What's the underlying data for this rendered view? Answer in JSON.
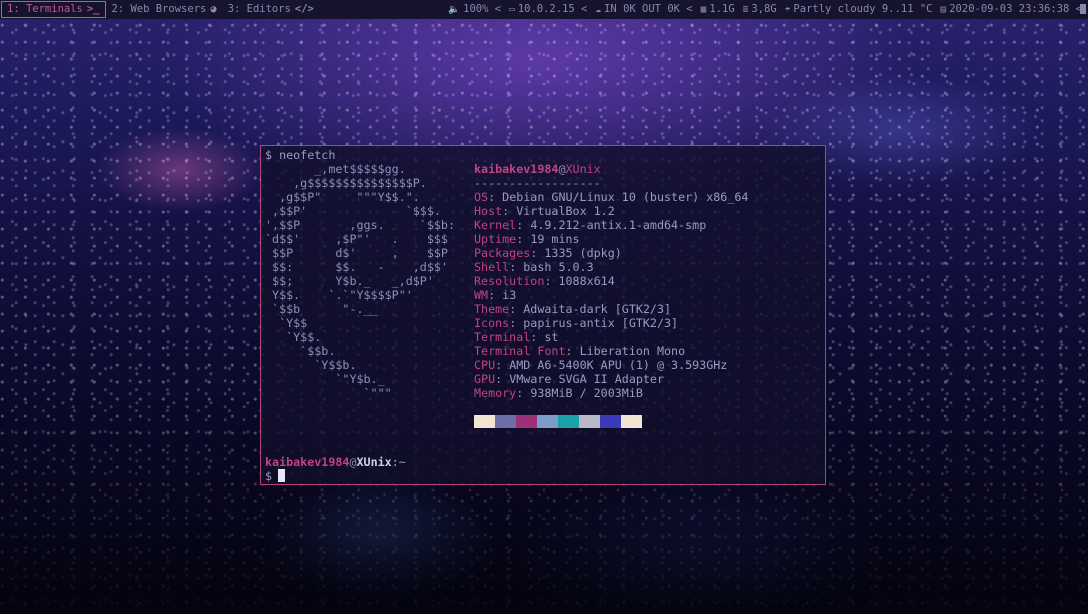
{
  "topbar": {
    "workspaces": [
      {
        "label": "1: Terminals",
        "icon": ">_",
        "icon_name": "terminal-icon",
        "active": true
      },
      {
        "label": "2: Web Browsers",
        "icon": "◕",
        "icon_name": "globe-icon",
        "active": false
      },
      {
        "label": "3: Editors",
        "icon": "</>",
        "icon_name": "code-icon",
        "active": false
      }
    ],
    "status": [
      {
        "icon": "🔈",
        "icon_name": "volume-icon",
        "text": "100% <"
      },
      {
        "icon": "▭",
        "icon_name": "network-icon",
        "text": "10.0.2.15 <"
      },
      {
        "icon": "☁",
        "icon_name": "cloud-traffic-icon",
        "text": "IN 0K OUT 0K <"
      },
      {
        "icon": "▦",
        "icon_name": "memory-icon",
        "text": "1.1G"
      },
      {
        "icon": "≣",
        "icon_name": "disk-icon",
        "text": "3,8G"
      },
      {
        "icon": "☂",
        "icon_name": "weather-icon",
        "text": "Partly cloudy 9..11 °C"
      },
      {
        "icon": "▤",
        "icon_name": "calendar-icon",
        "text": "2020-09-03 23:36:38 <"
      }
    ]
  },
  "terminal": {
    "command_prompt": "$ neofetch",
    "ascii_art": "       _,met$$$$$gg.\n    ,g$$$$$$$$$$$$$$$P.\n  ,g$$P\"     \"\"\"Y$$.\".\n ,$$P'              `$$$.\n',$$P       ,ggs.     `$$b:\n`d$$'     ,$P\"'   .    $$$\n $$P      d$'     ,    $$P\n $$:      $$.   -    ,d$$'\n $$;      Y$b._   _,d$P'\n Y$$.    `.`\"Y$$$$P\"'\n `$$b      \"-.__\n  `Y$$\n   `Y$$.\n     `$$b.\n       `Y$$b.\n          `\"Y$b._\n              `\"\"\"",
    "user": "kaibakev1984",
    "at": "@",
    "host": "XUnix",
    "separator": "------------------",
    "info": [
      {
        "key": "OS",
        "value": "Debian GNU/Linux 10 (buster) x86_64"
      },
      {
        "key": "Host",
        "value": "VirtualBox 1.2"
      },
      {
        "key": "Kernel",
        "value": "4.9.212-antix.1-amd64-smp"
      },
      {
        "key": "Uptime",
        "value": "19 mins"
      },
      {
        "key": "Packages",
        "value": "1335 (dpkg)"
      },
      {
        "key": "Shell",
        "value": "bash 5.0.3"
      },
      {
        "key": "Resolution",
        "value": "1088x614"
      },
      {
        "key": "WM",
        "value": "i3"
      },
      {
        "key": "Theme",
        "value": "Adwaita-dark [GTK2/3]"
      },
      {
        "key": "Icons",
        "value": "papirus-antix [GTK2/3]"
      },
      {
        "key": "Terminal",
        "value": "st"
      },
      {
        "key": "Terminal Font",
        "value": "Liberation Mono"
      },
      {
        "key": "CPU",
        "value": "AMD A6-5400K APU (1) @ 3.593GHz"
      },
      {
        "key": "GPU",
        "value": "VMware SVGA II Adapter"
      },
      {
        "key": "Memory",
        "value": "938MiB / 2003MiB"
      }
    ],
    "palette": [
      "#f1e4d3",
      "#6d6fa6",
      "#9c3177",
      "#7c9cc9",
      "#1ba2a9",
      "#b8b8c6",
      "#3b3ab8",
      "#f1e4d3"
    ],
    "final_prompt_user": "kaibakev1984",
    "final_prompt_at": "@",
    "final_prompt_host": "XUnix",
    "final_prompt_path": ":~",
    "final_prompt_symbol": "$"
  }
}
